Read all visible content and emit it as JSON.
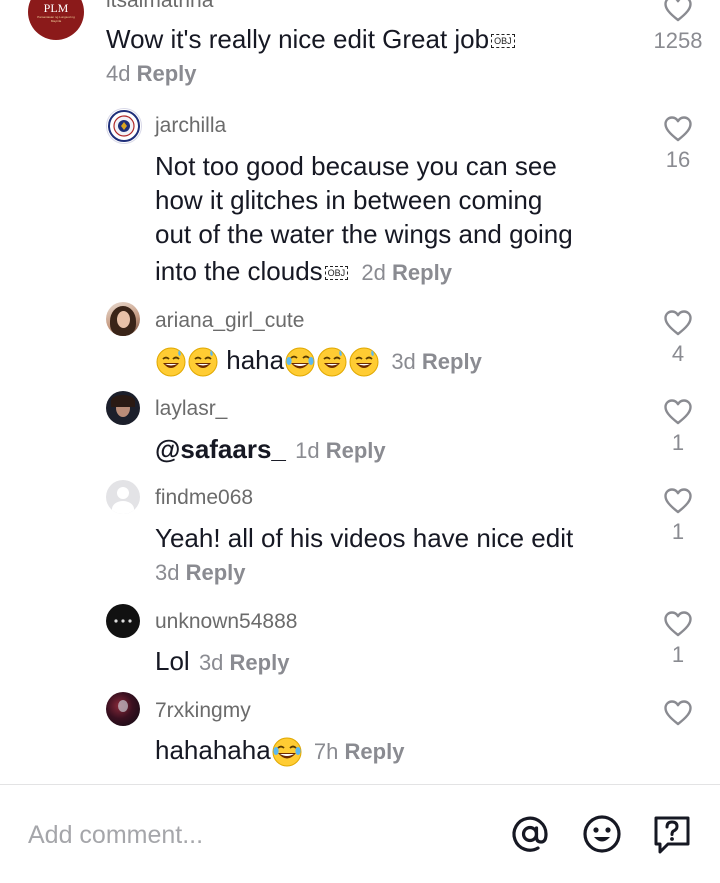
{
  "comments": [
    {
      "username": "itsalmatrina",
      "text": "Wow it's really nice edit Great job",
      "obj_marker": "OBJ",
      "time": "4d",
      "reply_label": "Reply",
      "likes": "1258",
      "avatar_label": "PLM",
      "avatar_sublabel": "Pamantasan ng Lungsod ng Maynila"
    },
    {
      "username": "jarchilla",
      "text_lines": [
        "Not too good because you can see",
        "how it glitches in between coming",
        "out of the water the wings and going",
        "into the clouds"
      ],
      "obj_marker": "OBJ",
      "time": "2d",
      "reply_label": "Reply",
      "likes": "16"
    },
    {
      "username": "ariana_girl_cute",
      "text": "haha",
      "time": "3d",
      "reply_label": "Reply",
      "likes": "4"
    },
    {
      "username": "laylasr_",
      "text": "@safaars_",
      "time": "1d",
      "reply_label": "Reply",
      "likes": "1"
    },
    {
      "username": "findme068",
      "text": "Yeah! all of his videos have nice edit",
      "time": "3d",
      "reply_label": "Reply",
      "likes": "1"
    },
    {
      "username": "unknown54888",
      "text": "Lol",
      "time": "3d",
      "reply_label": "Reply",
      "likes": "1"
    },
    {
      "username": "7rxkingmy",
      "text": "hahahaha",
      "time": "7h",
      "reply_label": "Reply",
      "likes": ""
    }
  ],
  "composer": {
    "placeholder": "Add comment...",
    "icons": [
      "at-mention-icon",
      "emoji-icon",
      "question-icon"
    ]
  },
  "colors": {
    "text": "#161823",
    "secondary": "#8a8b91",
    "username": "#6b6b6b",
    "heart": "#8a8b91",
    "plm_maroon": "#8b1a1a"
  }
}
